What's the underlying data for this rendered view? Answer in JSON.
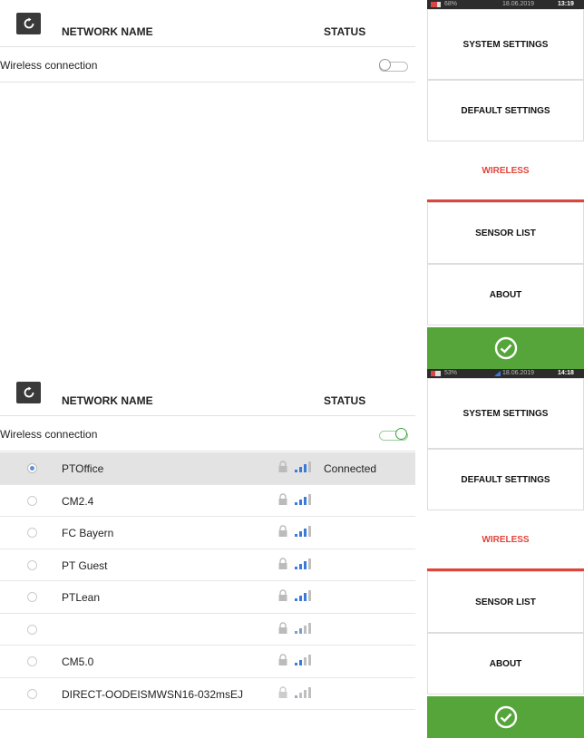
{
  "screens": [
    {
      "header": {
        "col_name": "NETWORK NAME",
        "col_status": "STATUS"
      },
      "wireless_label": "Wireless connection",
      "wireless_on": false,
      "networks": [],
      "status_bar": {
        "battery": "68%",
        "date": "18.06.2019",
        "time": "13:19"
      },
      "menu": [
        "SYSTEM SETTINGS",
        "DEFAULT SETTINGS",
        "WIRELESS",
        "SENSOR LIST",
        "ABOUT"
      ],
      "active_menu": "WIRELESS"
    },
    {
      "header": {
        "col_name": "NETWORK NAME",
        "col_status": "STATUS"
      },
      "wireless_label": "Wireless connection",
      "wireless_on": true,
      "networks": [
        {
          "name": "PTOffice",
          "status": "Connected",
          "selected": true
        },
        {
          "name": "CM2.4",
          "status": "",
          "selected": false
        },
        {
          "name": "FC Bayern",
          "status": "",
          "selected": false
        },
        {
          "name": "PT Guest",
          "status": "",
          "selected": false
        },
        {
          "name": "PTLean",
          "status": "",
          "selected": false
        },
        {
          "name": "",
          "status": "",
          "selected": false
        },
        {
          "name": "CM5.0",
          "status": "",
          "selected": false
        },
        {
          "name": "DIRECT-OODEISMWSN16-032msEJ",
          "status": "",
          "selected": false
        }
      ],
      "status_bar": {
        "battery": "53%",
        "date": "18.06.2019",
        "time": "14:18"
      },
      "menu": [
        "SYSTEM SETTINGS",
        "DEFAULT SETTINGS",
        "WIRELESS",
        "SENSOR LIST",
        "ABOUT"
      ],
      "active_menu": "WIRELESS"
    }
  ],
  "icons": {
    "refresh": "refresh-icon",
    "lock": "lock-icon",
    "signal": "wifi-signal-icon",
    "confirm": "check-circle-icon"
  },
  "colors": {
    "accent_active": "#e0453a",
    "confirm_green": "#55a53a",
    "toggle_on": "#3aa23a",
    "signal_blue": "#3a7ad8"
  }
}
